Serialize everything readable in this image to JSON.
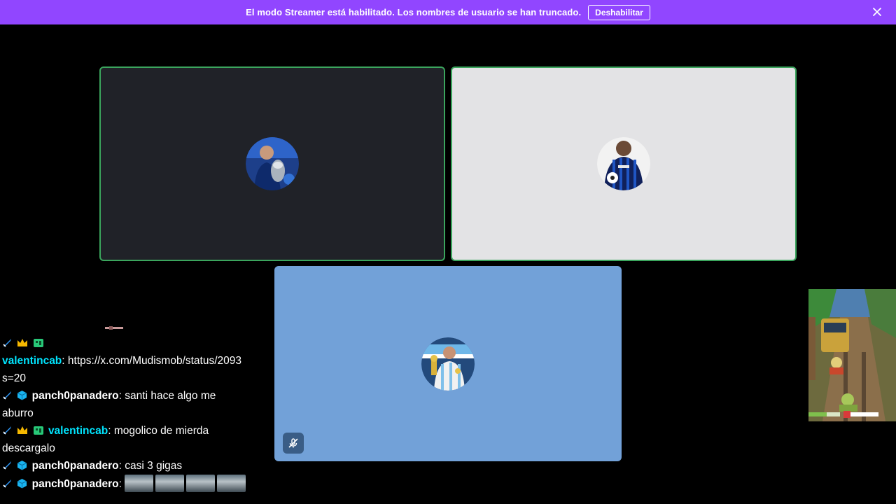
{
  "banner": {
    "message": "El modo Streamer está habilitado. Los nombres de usuario se han truncado.",
    "button_label": "Deshabilitar",
    "background": "#9146ff",
    "close_icon": "close-icon"
  },
  "tiles": [
    {
      "name": "participant-1",
      "speaking": true,
      "bg": "#202228"
    },
    {
      "name": "participant-2",
      "speaking": true,
      "bg": "#e3e3e5"
    },
    {
      "name": "participant-3",
      "speaking": false,
      "muted": true,
      "bg": "#72a1d8"
    }
  ],
  "chat": {
    "messages": [
      {
        "badges": [
          "sword-icon",
          "crown-icon",
          "gift-icon"
        ],
        "user": "",
        "text": ""
      },
      {
        "badges": [],
        "user": "valentincab",
        "text": "https://x.com/Mudismob/status/2093",
        "continuation": "s=20"
      },
      {
        "badges": [
          "sword-icon",
          "cube-icon"
        ],
        "user": "panch0panadero",
        "text": "santi hace algo me",
        "continuation": "aburro"
      },
      {
        "badges": [
          "sword-icon",
          "crown-icon",
          "gift-icon"
        ],
        "user": "valentincab",
        "text": "mogolico de mierda",
        "continuation": "descargalo"
      },
      {
        "badges": [
          "sword-icon",
          "cube-icon"
        ],
        "user": "panch0panadero",
        "text": "casi 3 gigas"
      },
      {
        "badges": [
          "sword-icon",
          "cube-icon"
        ],
        "user": "panch0panadero",
        "text": "",
        "emotes": 4
      }
    ]
  },
  "colors": {
    "accent": "#9146ff",
    "speaking": "#3ba55d",
    "username_cyan": "#00e5ff"
  }
}
